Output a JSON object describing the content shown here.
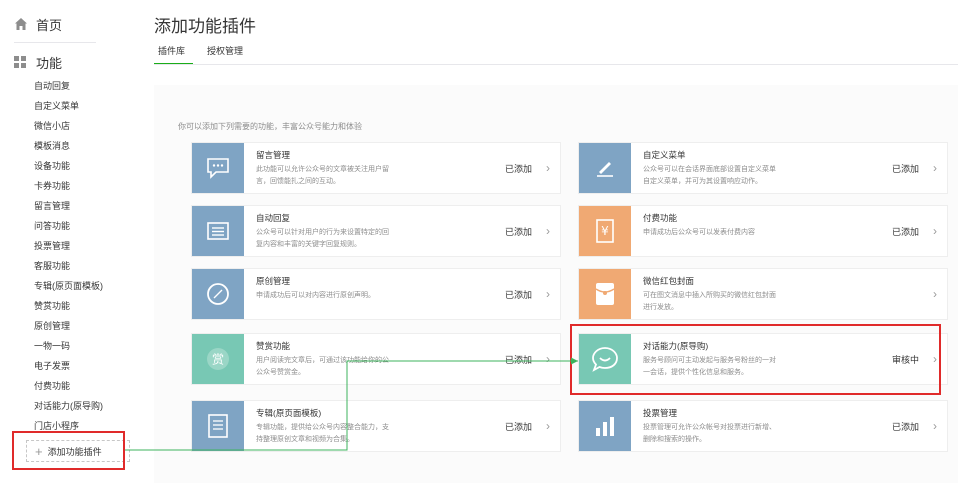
{
  "sidebar": {
    "home_label": "首页",
    "function_label": "功能",
    "items": [
      "自动回复",
      "自定义菜单",
      "微信小店",
      "模板消息",
      "设备功能",
      "卡券功能",
      "留言管理",
      "问答功能",
      "投票管理",
      "客服功能",
      "专辑(原页面模板)",
      "赞赏功能",
      "原创管理",
      "一物一码",
      "电子发票",
      "付费功能",
      "对话能力(原导购)",
      "门店小程序"
    ],
    "add_plugin_label": "添加功能插件"
  },
  "header": {
    "title": "添加功能插件",
    "tabs": [
      "插件库",
      "授权管理"
    ]
  },
  "main": {
    "intro": "你可以添加下列需要的功能，丰富公众号能力和体验",
    "cards_left": [
      {
        "name": "留言管理",
        "desc1": "此功能可以允许公众号的文章被关注用户留",
        "desc2": "言，回馈能扎之间的互动。",
        "status": "已添加",
        "icon": "comment-icon",
        "color": "#7fa4c4"
      },
      {
        "name": "自动回复",
        "desc1": "公众号可以针对用户的行为来设置特定的回",
        "desc2": "复内容和丰富的关键字回复规则。",
        "status": "已添加",
        "icon": "list-icon",
        "color": "#7fa4c4"
      },
      {
        "name": "原创管理",
        "desc1": "申请成功后可以对内容进行原创声明。",
        "desc2": "",
        "status": "已添加",
        "icon": "compass-icon",
        "color": "#7fa4c4"
      },
      {
        "name": "赞赏功能",
        "desc1": "用户阅读完文章后，可通过该功能给你的公",
        "desc2": "公众号赞赏金。",
        "status": "已添加",
        "icon": "reward-icon",
        "color": "#78c8b4"
      },
      {
        "name": "专辑(原页面模板)",
        "desc1": "专辑功能，提供给公众号内容整合能力，支",
        "desc2": "持整理原创文章和视频为合集。",
        "status": "已添加",
        "icon": "document-icon",
        "color": "#7fa4c4"
      }
    ],
    "cards_right": [
      {
        "name": "自定义菜单",
        "desc1": "公众号可以在会话界面底部设置自定义菜单",
        "desc2": "自定义菜单，并可为其设置响应动作。",
        "status": "已添加",
        "icon": "edit-icon",
        "color": "#7fa4c4"
      },
      {
        "name": "付费功能",
        "desc1": "申请成功后公众号可以发表付费内容",
        "desc2": "",
        "status": "已添加",
        "icon": "yen-icon",
        "color": "#f0a973"
      },
      {
        "name": "微信红包封面",
        "desc1": "可在图文消息中插入所购买的微信红包封面",
        "desc2": "进行发放。",
        "status": "",
        "icon": "red-envelope-icon",
        "color": "#f0a973"
      },
      {
        "name": "对话能力(原导购)",
        "desc1": "服务号顾问可主动发起与服务号粉丝的一对",
        "desc2": "一会话，提供个性化信息和服务。",
        "status": "审核中",
        "icon": "chat-smile-icon",
        "color": "#78c8b4"
      },
      {
        "name": "投票管理",
        "desc1": "投票管理可允许公众帐号对投票进行新增、",
        "desc2": "删除和搜索的操作。",
        "status": "已添加",
        "icon": "bar-chart-icon",
        "color": "#7fa4c4"
      }
    ]
  }
}
